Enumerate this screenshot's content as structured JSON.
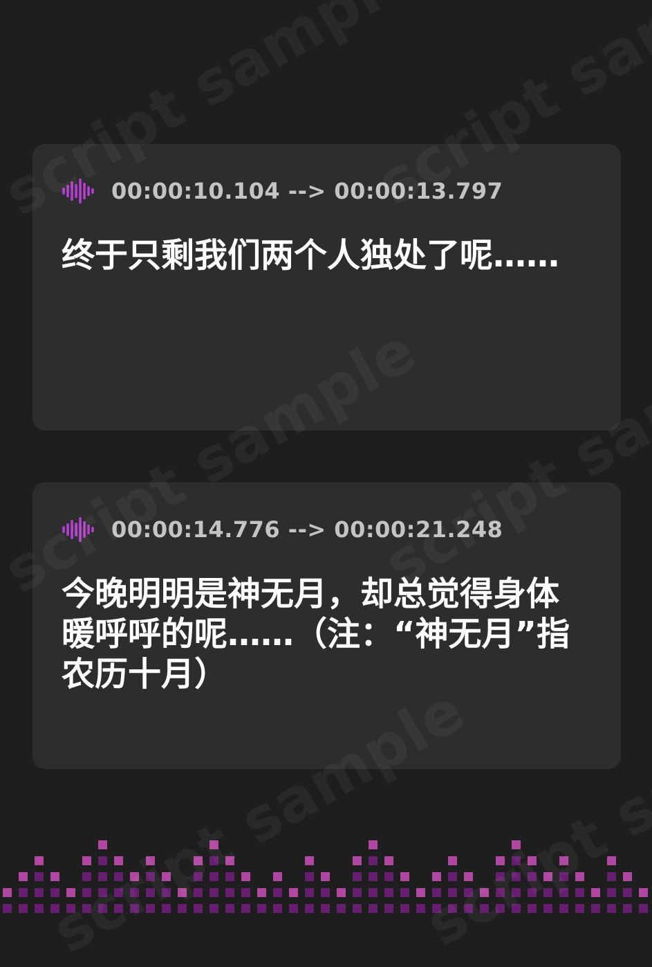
{
  "watermark": "script sample",
  "colors": {
    "background": "#1e1e1f",
    "card": "#2d2d2e",
    "timestamp": "#c4c4c4",
    "text": "#ffffff",
    "icon_gradient_start": "#8a2cc8",
    "icon_gradient_end": "#e04fd8",
    "eq_dark": "#6e1e78",
    "eq_light": "#b84aa8"
  },
  "entries": [
    {
      "icon": "sound-wave-icon",
      "timestamp": "00:00:10.104 --> 00:00:13.797",
      "text": "终于只剩我们两个人独处了呢……"
    },
    {
      "icon": "sound-wave-icon",
      "timestamp": "00:00:14.776 --> 00:00:21.248",
      "text": "今晚明明是神无月，却总觉得身体暖呼呼的呢……（注：“神无月”指农历十月）"
    }
  ],
  "equalizer": {
    "icon": "equalizer-decoration",
    "levels": [
      2,
      3,
      4,
      3,
      2,
      4,
      5,
      4,
      3,
      4,
      3,
      2,
      4,
      5,
      4,
      3,
      2,
      3,
      2,
      4,
      3,
      2,
      4,
      5,
      4,
      3,
      2,
      3,
      4,
      3,
      2,
      4,
      5,
      4,
      3,
      4,
      3,
      2,
      4,
      3,
      2
    ]
  }
}
